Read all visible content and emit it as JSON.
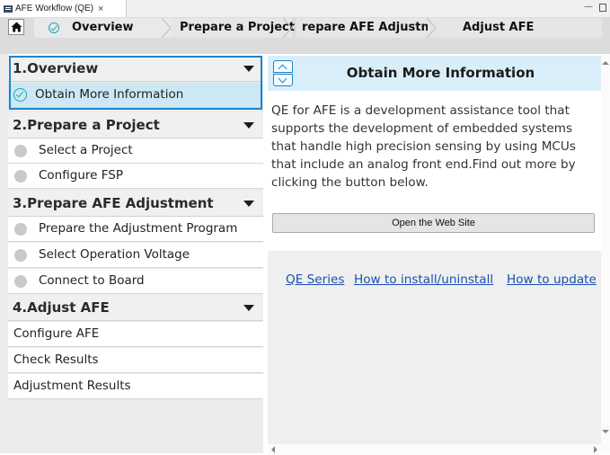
{
  "window": {
    "tab_title": "AFE Workflow (QE)",
    "tab_close": "×",
    "minimize": "▭"
  },
  "breadcrumb": {
    "items": [
      {
        "label": "Overview",
        "state": "complete"
      },
      {
        "label": "Prepare a Project"
      },
      {
        "label": "repare AFE Adjustm"
      },
      {
        "label": "Adjust AFE"
      }
    ]
  },
  "nav": {
    "sections": [
      {
        "label": "1.Overview",
        "items": [
          {
            "label": "Obtain More Information",
            "selected": true
          }
        ]
      },
      {
        "label": "2.Prepare a Project",
        "items": [
          {
            "label": "Select a Project"
          },
          {
            "label": "Configure FSP"
          }
        ]
      },
      {
        "label": "3.Prepare AFE Adjustment",
        "items": [
          {
            "label": "Prepare the Adjustment Program"
          },
          {
            "label": "Select Operation Voltage"
          },
          {
            "label": "Connect to Board"
          }
        ]
      },
      {
        "label": "4.Adjust AFE",
        "items": [
          {
            "label": "Configure AFE"
          },
          {
            "label": "Check Results"
          },
          {
            "label": "Adjustment Results"
          }
        ]
      }
    ]
  },
  "content": {
    "title": "Obtain More Information",
    "description": "QE for AFE is a development assistance tool that supports the development of embedded systems that handle high precision sensing by using MCUs that include an analog front end.Find out more by clicking the button below.",
    "button_label": "Open the Web Site",
    "links": [
      "QE Series",
      "How to install/uninstall",
      "How to update"
    ]
  },
  "colors": {
    "accent": "#17a6b8",
    "focus": "#1e86c8",
    "selected_bg": "#cce8f4",
    "header_bg": "#d9eef9",
    "link": "#1a4fb3"
  }
}
